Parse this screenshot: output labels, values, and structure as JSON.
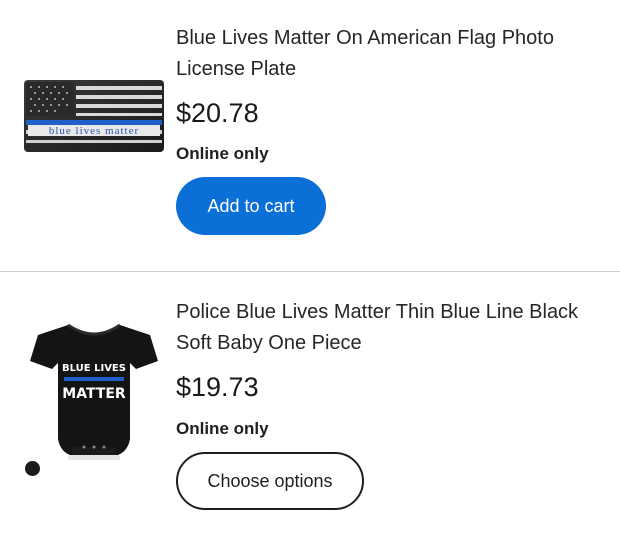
{
  "products": [
    {
      "image_icon": "license-plate-image",
      "image_text": "blue lives matter",
      "title": "Blue Lives Matter On American Flag Photo License Plate",
      "price": "$20.78",
      "availability": "Online only",
      "button_label": "Add to cart"
    },
    {
      "image_icon": "baby-onesie-image",
      "image_text_line1": "BLUE LIVES",
      "image_text_line2": "MATTER",
      "title": "Police Blue Lives Matter Thin Blue Line Black Soft Baby One Piece",
      "price": "$19.73",
      "availability": "Online only",
      "button_label": "Choose options"
    }
  ],
  "colors": {
    "primary_button": "#0a6fd6",
    "thin_blue_line": "#1e5fc9",
    "divider": "#cfcfcf"
  }
}
